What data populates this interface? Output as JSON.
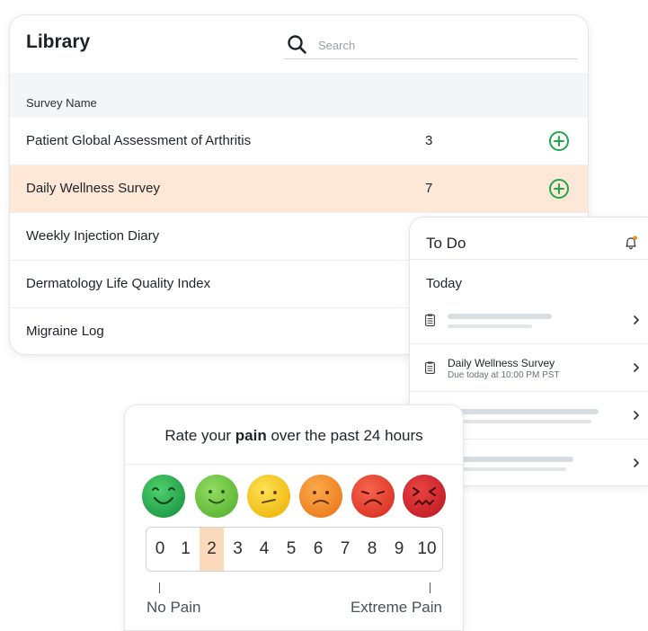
{
  "library": {
    "title": "Library",
    "search_placeholder": "Search",
    "column_header": "Survey Name",
    "rows": [
      {
        "name": "Patient Global Assessment of Arthritis",
        "count": "3"
      },
      {
        "name": "Daily Wellness Survey",
        "count": "7"
      },
      {
        "name": "Weekly Injection Diary",
        "count": ""
      },
      {
        "name": "Dermatology Life Quality Index",
        "count": ""
      },
      {
        "name": "Migraine Log",
        "count": ""
      }
    ],
    "selected_row": 1
  },
  "todo": {
    "title": "To Do",
    "section": "Today",
    "item": {
      "title": "Daily Wellness Survey",
      "subtitle": "Due today at 10:00 PM PST"
    }
  },
  "pain": {
    "question_prefix": "Rate your ",
    "question_bold": "pain",
    "question_suffix": " over the past 24 hours",
    "scale": [
      "0",
      "1",
      "2",
      "3",
      "4",
      "5",
      "6",
      "7",
      "8",
      "9",
      "10"
    ],
    "selected": "2",
    "low_label": "No Pain",
    "high_label": "Extreme Pain",
    "faces": [
      "#22a64a",
      "#6fc43f",
      "#f2c31a",
      "#f08a2a",
      "#e8402f",
      "#d42a2f"
    ]
  },
  "colors": {
    "accent_green": "#22a64a",
    "selected_row_bg": "#fde8d7",
    "selected_number_bg": "#fbd9bb",
    "notification_dot": "#f08a2a"
  },
  "icons": [
    "search-icon",
    "add-circle-icon",
    "bell-icon",
    "document-icon",
    "chevron-right-icon"
  ]
}
